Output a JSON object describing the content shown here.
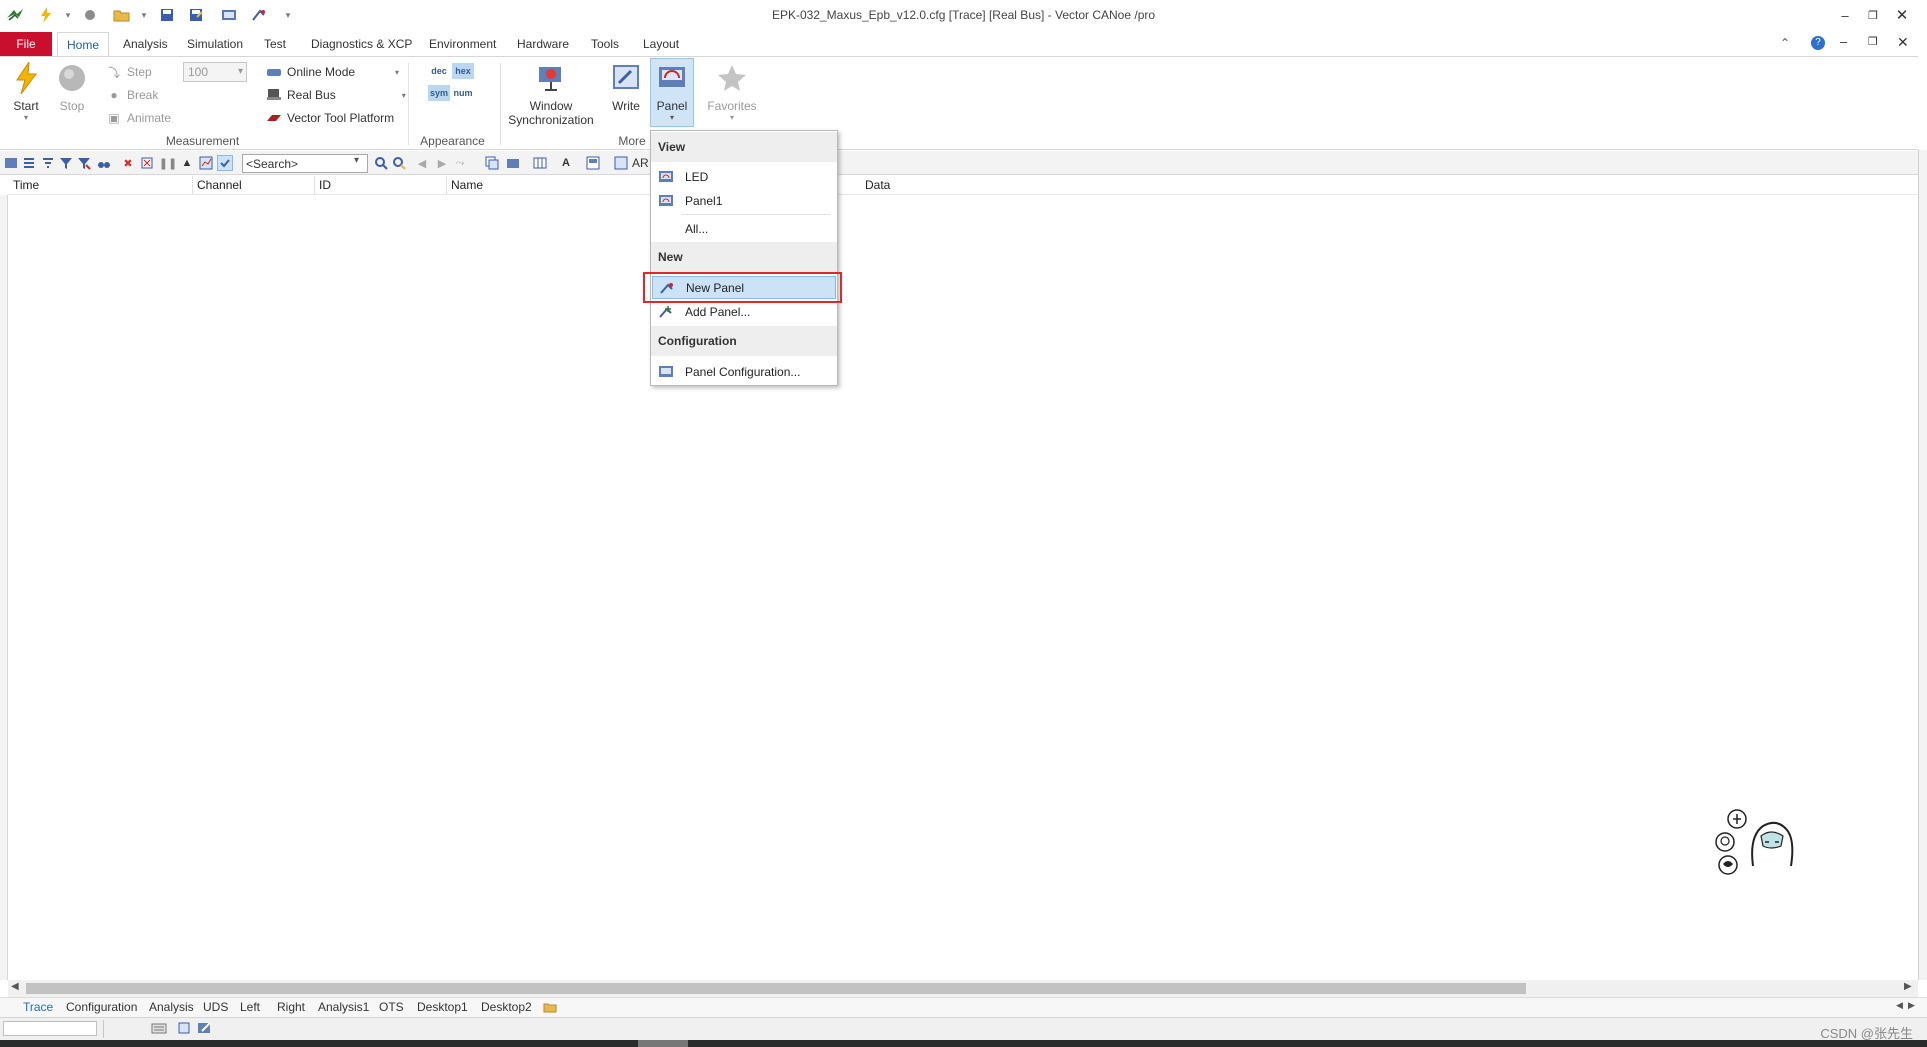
{
  "window": {
    "title": "EPK-032_Maxus_Epb_v12.0.cfg [Trace] [Real Bus] - Vector CANoe /pro"
  },
  "ribbon_tabs": [
    "Home",
    "Analysis",
    "Simulation",
    "Test",
    "Diagnostics & XCP",
    "Environment",
    "Hardware",
    "Tools",
    "Layout"
  ],
  "file_tab": "File",
  "ribbon": {
    "start": "Start",
    "stop": "Stop",
    "step": "Step",
    "break": "Break",
    "animate": "Animate",
    "step_value": "100",
    "online_mode": "Online Mode",
    "real_bus": "Real Bus",
    "vector_tool_platform": "Vector Tool Platform",
    "group_measurement": "Measurement",
    "fmt_dec": "dec",
    "fmt_hex": "hex",
    "fmt_sym": "sym",
    "fmt_num": "num",
    "group_appearance": "Appearance",
    "window_sync_1": "Window",
    "window_sync_2": "Synchronization",
    "write": "Write",
    "panel": "Panel",
    "favorites": "Favorites",
    "group_more": "More"
  },
  "toolbar": {
    "search_value": "<Search>",
    "ar_label": "AR"
  },
  "trace_columns": [
    "Time",
    "Channel",
    "ID",
    "Name",
    "Data"
  ],
  "panel_menu": {
    "view_header": "View",
    "view_items": [
      "LED",
      "Panel1"
    ],
    "all_item": "All...",
    "new_header": "New",
    "new_panel": "New Panel",
    "add_panel": "Add Panel...",
    "config_header": "Configuration",
    "panel_configuration": "Panel Configuration..."
  },
  "bottom_tabs": [
    "Trace",
    "Configuration",
    "Analysis",
    "UDS",
    "Left",
    "Right",
    "Analysis1",
    "OTS",
    "Desktop1",
    "Desktop2"
  ],
  "status": {
    "watermark": "CSDN @张先生"
  },
  "colors": {
    "file_tab": "#c8102e",
    "active_tab_text": "#1e5fa8",
    "menu_highlight": "#cbe2f7",
    "annotation_box": "#e3262b"
  }
}
